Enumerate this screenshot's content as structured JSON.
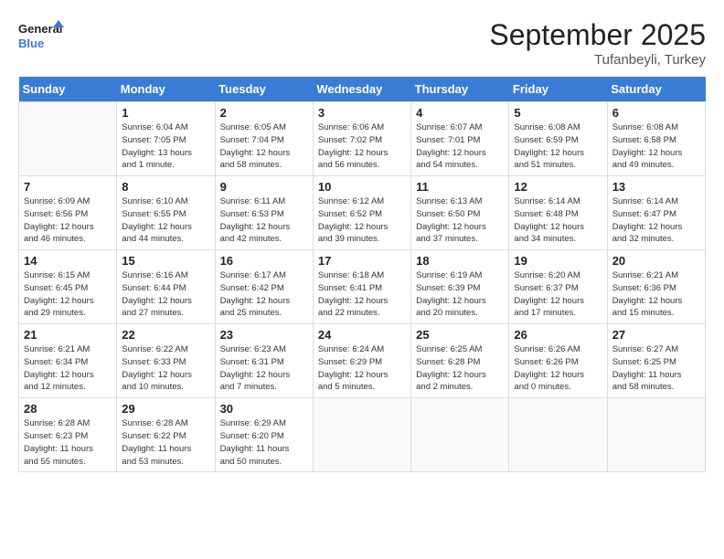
{
  "header": {
    "logo_line1": "General",
    "logo_line2": "Blue",
    "month": "September 2025",
    "location": "Tufanbeyli, Turkey"
  },
  "days_of_week": [
    "Sunday",
    "Monday",
    "Tuesday",
    "Wednesday",
    "Thursday",
    "Friday",
    "Saturday"
  ],
  "weeks": [
    [
      {
        "day": "",
        "info": ""
      },
      {
        "day": "1",
        "info": "Sunrise: 6:04 AM\nSunset: 7:05 PM\nDaylight: 13 hours\nand 1 minute."
      },
      {
        "day": "2",
        "info": "Sunrise: 6:05 AM\nSunset: 7:04 PM\nDaylight: 12 hours\nand 58 minutes."
      },
      {
        "day": "3",
        "info": "Sunrise: 6:06 AM\nSunset: 7:02 PM\nDaylight: 12 hours\nand 56 minutes."
      },
      {
        "day": "4",
        "info": "Sunrise: 6:07 AM\nSunset: 7:01 PM\nDaylight: 12 hours\nand 54 minutes."
      },
      {
        "day": "5",
        "info": "Sunrise: 6:08 AM\nSunset: 6:59 PM\nDaylight: 12 hours\nand 51 minutes."
      },
      {
        "day": "6",
        "info": "Sunrise: 6:08 AM\nSunset: 6:58 PM\nDaylight: 12 hours\nand 49 minutes."
      }
    ],
    [
      {
        "day": "7",
        "info": "Sunrise: 6:09 AM\nSunset: 6:56 PM\nDaylight: 12 hours\nand 46 minutes."
      },
      {
        "day": "8",
        "info": "Sunrise: 6:10 AM\nSunset: 6:55 PM\nDaylight: 12 hours\nand 44 minutes."
      },
      {
        "day": "9",
        "info": "Sunrise: 6:11 AM\nSunset: 6:53 PM\nDaylight: 12 hours\nand 42 minutes."
      },
      {
        "day": "10",
        "info": "Sunrise: 6:12 AM\nSunset: 6:52 PM\nDaylight: 12 hours\nand 39 minutes."
      },
      {
        "day": "11",
        "info": "Sunrise: 6:13 AM\nSunset: 6:50 PM\nDaylight: 12 hours\nand 37 minutes."
      },
      {
        "day": "12",
        "info": "Sunrise: 6:14 AM\nSunset: 6:48 PM\nDaylight: 12 hours\nand 34 minutes."
      },
      {
        "day": "13",
        "info": "Sunrise: 6:14 AM\nSunset: 6:47 PM\nDaylight: 12 hours\nand 32 minutes."
      }
    ],
    [
      {
        "day": "14",
        "info": "Sunrise: 6:15 AM\nSunset: 6:45 PM\nDaylight: 12 hours\nand 29 minutes."
      },
      {
        "day": "15",
        "info": "Sunrise: 6:16 AM\nSunset: 6:44 PM\nDaylight: 12 hours\nand 27 minutes."
      },
      {
        "day": "16",
        "info": "Sunrise: 6:17 AM\nSunset: 6:42 PM\nDaylight: 12 hours\nand 25 minutes."
      },
      {
        "day": "17",
        "info": "Sunrise: 6:18 AM\nSunset: 6:41 PM\nDaylight: 12 hours\nand 22 minutes."
      },
      {
        "day": "18",
        "info": "Sunrise: 6:19 AM\nSunset: 6:39 PM\nDaylight: 12 hours\nand 20 minutes."
      },
      {
        "day": "19",
        "info": "Sunrise: 6:20 AM\nSunset: 6:37 PM\nDaylight: 12 hours\nand 17 minutes."
      },
      {
        "day": "20",
        "info": "Sunrise: 6:21 AM\nSunset: 6:36 PM\nDaylight: 12 hours\nand 15 minutes."
      }
    ],
    [
      {
        "day": "21",
        "info": "Sunrise: 6:21 AM\nSunset: 6:34 PM\nDaylight: 12 hours\nand 12 minutes."
      },
      {
        "day": "22",
        "info": "Sunrise: 6:22 AM\nSunset: 6:33 PM\nDaylight: 12 hours\nand 10 minutes."
      },
      {
        "day": "23",
        "info": "Sunrise: 6:23 AM\nSunset: 6:31 PM\nDaylight: 12 hours\nand 7 minutes."
      },
      {
        "day": "24",
        "info": "Sunrise: 6:24 AM\nSunset: 6:29 PM\nDaylight: 12 hours\nand 5 minutes."
      },
      {
        "day": "25",
        "info": "Sunrise: 6:25 AM\nSunset: 6:28 PM\nDaylight: 12 hours\nand 2 minutes."
      },
      {
        "day": "26",
        "info": "Sunrise: 6:26 AM\nSunset: 6:26 PM\nDaylight: 12 hours\nand 0 minutes."
      },
      {
        "day": "27",
        "info": "Sunrise: 6:27 AM\nSunset: 6:25 PM\nDaylight: 11 hours\nand 58 minutes."
      }
    ],
    [
      {
        "day": "28",
        "info": "Sunrise: 6:28 AM\nSunset: 6:23 PM\nDaylight: 11 hours\nand 55 minutes."
      },
      {
        "day": "29",
        "info": "Sunrise: 6:28 AM\nSunset: 6:22 PM\nDaylight: 11 hours\nand 53 minutes."
      },
      {
        "day": "30",
        "info": "Sunrise: 6:29 AM\nSunset: 6:20 PM\nDaylight: 11 hours\nand 50 minutes."
      },
      {
        "day": "",
        "info": ""
      },
      {
        "day": "",
        "info": ""
      },
      {
        "day": "",
        "info": ""
      },
      {
        "day": "",
        "info": ""
      }
    ]
  ]
}
